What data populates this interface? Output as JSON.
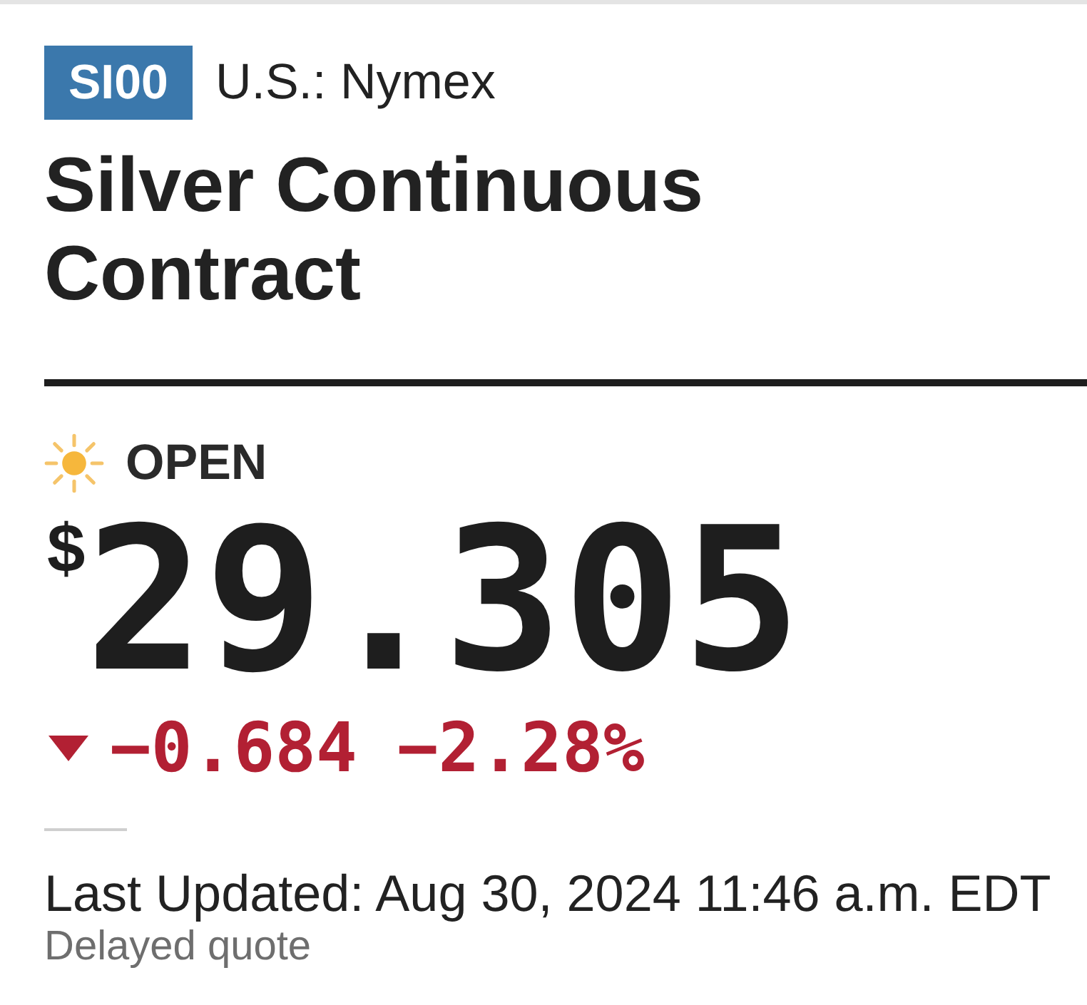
{
  "quote": {
    "ticker": "SI00",
    "exchange": "U.S.: Nymex",
    "name": "Silver Continuous Contract"
  },
  "market_status": {
    "kind": "open",
    "label": "OPEN"
  },
  "price": {
    "currency": "$",
    "value": "29.305"
  },
  "change": {
    "down": true,
    "amount": "−0.684",
    "percent": "−2.28%"
  },
  "footer": {
    "last_updated": "Last Updated: Aug 30, 2024 11:46 a.m. EDT",
    "note": "Delayed quote"
  }
}
